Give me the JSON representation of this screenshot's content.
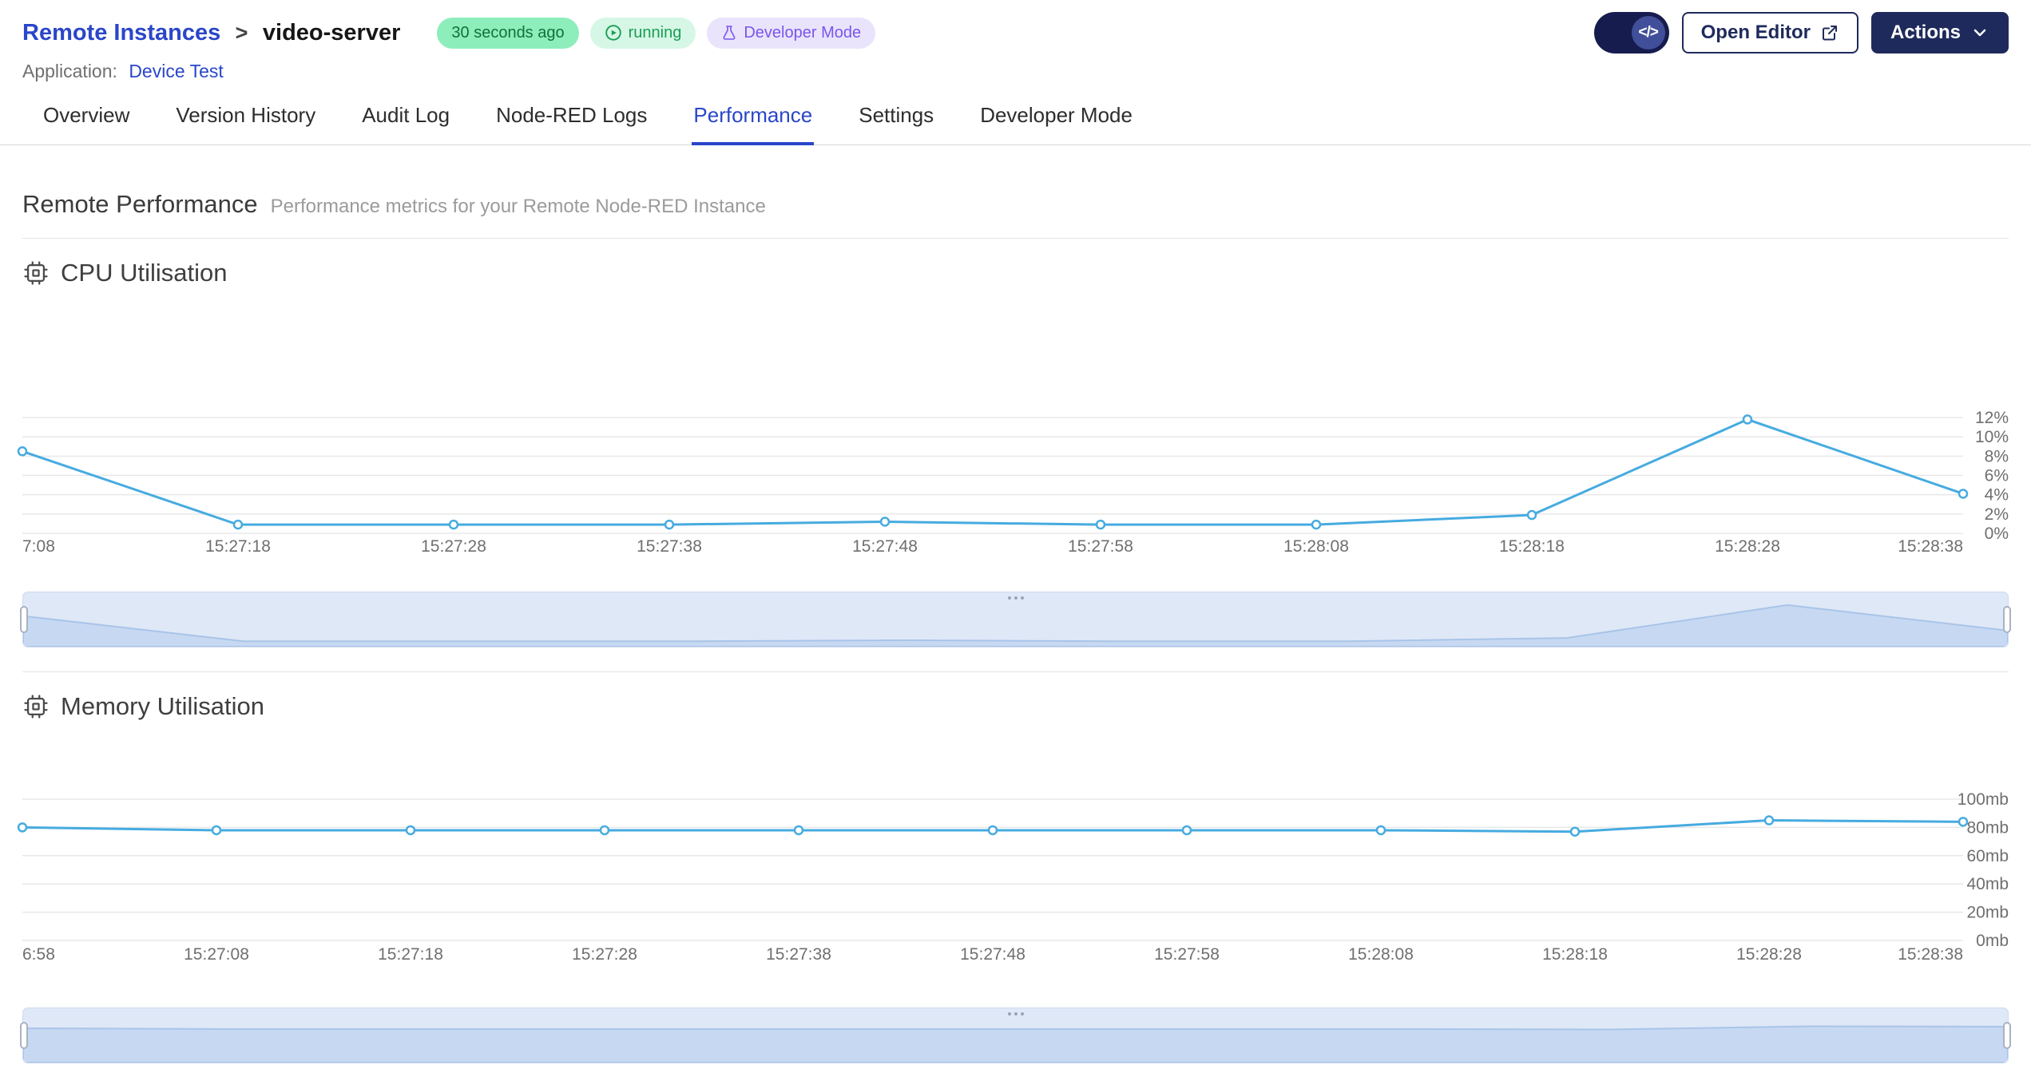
{
  "header": {
    "breadcrumb": {
      "section": "Remote Instances",
      "separator": ">",
      "name": "video-server"
    },
    "badges": {
      "last_updated": "30 seconds ago",
      "status": "running",
      "dev_mode": "Developer Mode"
    },
    "application": {
      "label": "Application:",
      "value": "Device Test"
    },
    "toolbar": {
      "code_toggle": "</>",
      "open_editor": "Open Editor",
      "actions": "Actions"
    }
  },
  "tabs": [
    {
      "label": "Overview",
      "active": false
    },
    {
      "label": "Version History",
      "active": false
    },
    {
      "label": "Audit Log",
      "active": false
    },
    {
      "label": "Node-RED Logs",
      "active": false
    },
    {
      "label": "Performance",
      "active": true
    },
    {
      "label": "Settings",
      "active": false
    },
    {
      "label": "Developer Mode",
      "active": false
    }
  ],
  "section": {
    "title": "Remote Performance",
    "subtitle": "Performance metrics for your Remote Node-RED Instance"
  },
  "colors": {
    "accent_blue": "#2a46c9",
    "navy": "#1f2a5c",
    "chart_line": "#46abe0",
    "badge_age_bg": "#8deebb",
    "badge_age_text": "#11713c",
    "status_bg": "#d6f7e6",
    "status_text": "#1a9e53",
    "dev_badge_bg": "#e9e4fb",
    "dev_badge_text": "#7a55ec",
    "brush_area": "#c7d9f2"
  },
  "chart_data": [
    {
      "type": "line",
      "title": "CPU Utilisation",
      "x": [
        "7:08",
        "15:27:18",
        "15:27:28",
        "15:27:38",
        "15:27:48",
        "15:27:58",
        "15:28:08",
        "15:28:18",
        "15:28:28",
        "15:28:38"
      ],
      "values": [
        8.5,
        0.9,
        0.9,
        0.9,
        1.2,
        0.9,
        0.9,
        1.9,
        11.8,
        4.1
      ],
      "ylim": [
        0,
        12
      ],
      "yticks": [
        0,
        2,
        4,
        6,
        8,
        10,
        12
      ],
      "ytick_labels": [
        "0%",
        "2%",
        "4%",
        "6%",
        "8%",
        "10%",
        "12%"
      ],
      "y_axis_position": "right",
      "grid": true,
      "legend": "none",
      "line_color": "#46abe0"
    },
    {
      "type": "line",
      "title": "Memory Utilisation",
      "x": [
        "6:58",
        "15:27:08",
        "15:27:18",
        "15:27:28",
        "15:27:38",
        "15:27:48",
        "15:27:58",
        "15:28:08",
        "15:28:18",
        "15:28:28",
        "15:28:38"
      ],
      "values": [
        80,
        78,
        78,
        78,
        78,
        78,
        78,
        78,
        77,
        85,
        84
      ],
      "ylim": [
        0,
        100
      ],
      "yticks": [
        0,
        20,
        40,
        60,
        80,
        100
      ],
      "ytick_labels": [
        "0mb",
        "20mb",
        "40mb",
        "60mb",
        "80mb",
        "100mb"
      ],
      "y_axis_position": "right",
      "grid": true,
      "legend": "none",
      "line_color": "#46abe0"
    }
  ]
}
